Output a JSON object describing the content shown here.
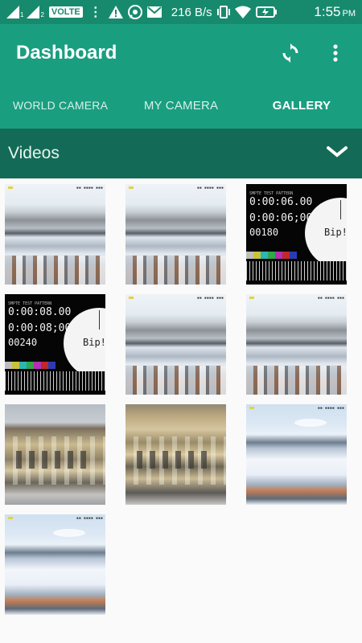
{
  "status_bar": {
    "sim1": "1",
    "sim2": "2",
    "volte": "VOLTE",
    "more": "⋮",
    "alert_icon": "warning-icon",
    "whatsapp_icon": "whatsapp-icon",
    "mail_icon": "mail-icon",
    "speed": "216 B/s",
    "vibrate_icon": "vibrate-icon",
    "wifi_icon": "wifi-icon",
    "battery_icon": "battery-charging-icon",
    "time": "1:55",
    "ampm": "PM"
  },
  "app_bar": {
    "title": "Dashboard",
    "refresh_icon": "refresh-icon",
    "menu_icon": "more-vert-icon"
  },
  "tabs": [
    {
      "label": "WORLD CAMERA"
    },
    {
      "label": "MY CAMERA"
    },
    {
      "label": "GALLERY",
      "active": true
    }
  ],
  "section": {
    "title": "Videos",
    "chevron_icon": "chevron-down-icon"
  },
  "videos": [
    {
      "kind": "city-scene"
    },
    {
      "kind": "city-scene"
    },
    {
      "kind": "test-pattern",
      "lines": [
        "0:00:06.00",
        "0:00:06;00",
        "00180"
      ],
      "bip": "Bip!"
    },
    {
      "kind": "test-pattern",
      "lines": [
        "0:00:08.00",
        "0:00:08;00",
        "00240"
      ],
      "bip": "Bip!"
    },
    {
      "kind": "city-scene"
    },
    {
      "kind": "city-scene"
    },
    {
      "kind": "building-street"
    },
    {
      "kind": "building-facade"
    },
    {
      "kind": "snow-scene"
    },
    {
      "kind": "snow-scene"
    }
  ],
  "colors": {
    "status_bar": "#178a6e",
    "app_bar": "#1a9e80",
    "section_bar": "#136b57",
    "background": "#fafafa"
  }
}
